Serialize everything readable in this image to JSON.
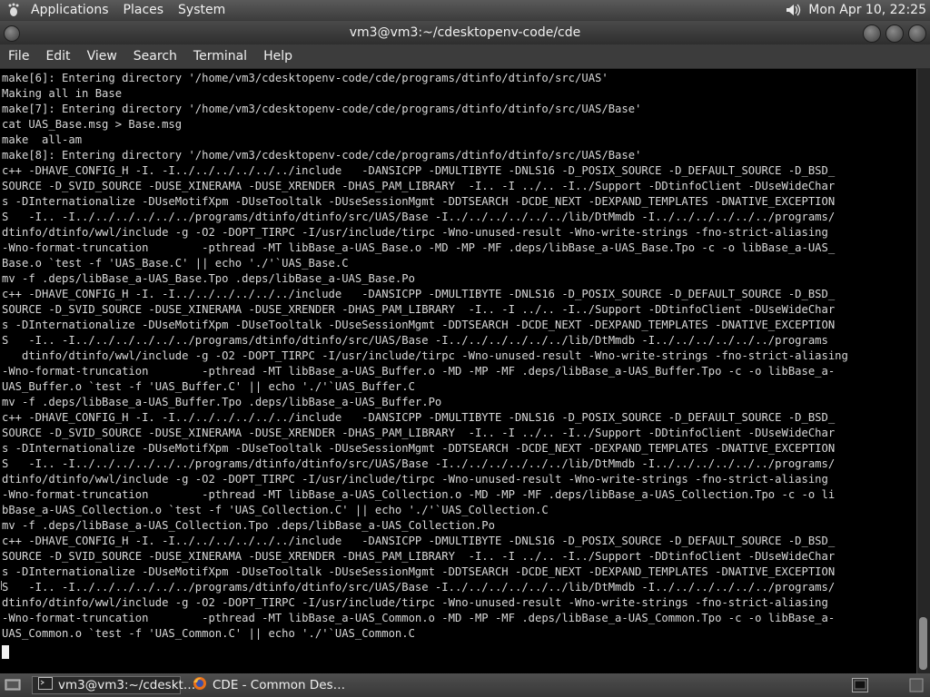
{
  "top_panel": {
    "menus": [
      "Applications",
      "Places",
      "System"
    ],
    "clock": "Mon Apr 10, 22:25"
  },
  "window": {
    "title": "vm3@vm3:~/cdesktopenv-code/cde",
    "menu": [
      "File",
      "Edit",
      "View",
      "Search",
      "Terminal",
      "Help"
    ]
  },
  "terminal": {
    "lines": [
      "make[6]: Entering directory '/home/vm3/cdesktopenv-code/cde/programs/dtinfo/dtinfo/src/UAS'",
      "Making all in Base",
      "make[7]: Entering directory '/home/vm3/cdesktopenv-code/cde/programs/dtinfo/dtinfo/src/UAS/Base'",
      "cat UAS_Base.msg > Base.msg",
      "make  all-am",
      "make[8]: Entering directory '/home/vm3/cdesktopenv-code/cde/programs/dtinfo/dtinfo/src/UAS/Base'",
      "c++ -DHAVE_CONFIG_H -I. -I../../../../../../include   -DANSICPP -DMULTIBYTE -DNLS16 -D_POSIX_SOURCE -D_DEFAULT_SOURCE -D_BSD_",
      "SOURCE -D_SVID_SOURCE -DUSE_XINERAMA -DUSE_XRENDER -DHAS_PAM_LIBRARY  -I.. -I ../.. -I../Support -DDtinfoClient -DUseWideChar",
      "s -DInternationalize -DUseMotifXpm -DUseTooltalk -DUseSessionMgmt -DDTSEARCH -DCDE_NEXT -DEXPAND_TEMPLATES -DNATIVE_EXCEPTION",
      "S   -I.. -I../../../../../../programs/dtinfo/dtinfo/src/UAS/Base -I../../../../../../lib/DtMmdb -I../../../../../../programs/",
      "dtinfo/dtinfo/wwl/include -g -O2 -DOPT_TIRPC -I/usr/include/tirpc -Wno-unused-result -Wno-write-strings -fno-strict-aliasing",
      "-Wno-format-truncation        -pthread -MT libBase_a-UAS_Base.o -MD -MP -MF .deps/libBase_a-UAS_Base.Tpo -c -o libBase_a-UAS_",
      "Base.o `test -f 'UAS_Base.C' || echo './'`UAS_Base.C",
      "mv -f .deps/libBase_a-UAS_Base.Tpo .deps/libBase_a-UAS_Base.Po",
      "c++ -DHAVE_CONFIG_H -I. -I../../../../../../include   -DANSICPP -DMULTIBYTE -DNLS16 -D_POSIX_SOURCE -D_DEFAULT_SOURCE -D_BSD_",
      "SOURCE -D_SVID_SOURCE -DUSE_XINERAMA -DUSE_XRENDER -DHAS_PAM_LIBRARY  -I.. -I ../.. -I../Support -DDtinfoClient -DUseWideChar",
      "s -DInternationalize -DUseMotifXpm -DUseTooltalk -DUseSessionMgmt -DDTSEARCH -DCDE_NEXT -DEXPAND_TEMPLATES -DNATIVE_EXCEPTION",
      "S   -I.. -I../../../../../../programs/dtinfo/dtinfo/src/UAS/Base -I../../../../../../lib/DtMmdb -I../../../../../../programs",
      "   dtinfo/dtinfo/wwl/include -g -O2 -DOPT_TIRPC -I/usr/include/tirpc -Wno-unused-result -Wno-write-strings -fno-strict-aliasing",
      "-Wno-format-truncation        -pthread -MT libBase_a-UAS_Buffer.o -MD -MP -MF .deps/libBase_a-UAS_Buffer.Tpo -c -o libBase_a-",
      "UAS_Buffer.o `test -f 'UAS_Buffer.C' || echo './'`UAS_Buffer.C",
      "mv -f .deps/libBase_a-UAS_Buffer.Tpo .deps/libBase_a-UAS_Buffer.Po",
      "c++ -DHAVE_CONFIG_H -I. -I../../../../../../include   -DANSICPP -DMULTIBYTE -DNLS16 -D_POSIX_SOURCE -D_DEFAULT_SOURCE -D_BSD_",
      "SOURCE -D_SVID_SOURCE -DUSE_XINERAMA -DUSE_XRENDER -DHAS_PAM_LIBRARY  -I.. -I ../.. -I../Support -DDtinfoClient -DUseWideChar",
      "s -DInternationalize -DUseMotifXpm -DUseTooltalk -DUseSessionMgmt -DDTSEARCH -DCDE_NEXT -DEXPAND_TEMPLATES -DNATIVE_EXCEPTION",
      "S   -I.. -I../../../../../../programs/dtinfo/dtinfo/src/UAS/Base -I../../../../../../lib/DtMmdb -I../../../../../../programs/",
      "dtinfo/dtinfo/wwl/include -g -O2 -DOPT_TIRPC -I/usr/include/tirpc -Wno-unused-result -Wno-write-strings -fno-strict-aliasing",
      "-Wno-format-truncation        -pthread -MT libBase_a-UAS_Collection.o -MD -MP -MF .deps/libBase_a-UAS_Collection.Tpo -c -o li",
      "bBase_a-UAS_Collection.o `test -f 'UAS_Collection.C' || echo './'`UAS_Collection.C",
      "mv -f .deps/libBase_a-UAS_Collection.Tpo .deps/libBase_a-UAS_Collection.Po",
      "c++ -DHAVE_CONFIG_H -I. -I../../../../../../include   -DANSICPP -DMULTIBYTE -DNLS16 -D_POSIX_SOURCE -D_DEFAULT_SOURCE -D_BSD_",
      "SOURCE -D_SVID_SOURCE -DUSE_XINERAMA -DUSE_XRENDER -DHAS_PAM_LIBRARY  -I.. -I ../.. -I../Support -DDtinfoClient -DUseWideChar",
      "s -DInternationalize -DUseMotifXpm -DUseTooltalk -DUseSessionMgmt -DDTSEARCH -DCDE_NEXT -DEXPAND_TEMPLATES -DNATIVE_EXCEPTION",
      "S   -I.. -I../../../../../../programs/dtinfo/dtinfo/src/UAS/Base -I../../../../../../lib/DtMmdb -I../../../../../../programs/",
      "dtinfo/dtinfo/wwl/include -g -O2 -DOPT_TIRPC -I/usr/include/tirpc -Wno-unused-result -Wno-write-strings -fno-strict-aliasing",
      "-Wno-format-truncation        -pthread -MT libBase_a-UAS_Common.o -MD -MP -MF .deps/libBase_a-UAS_Common.Tpo -c -o libBase_a-",
      "UAS_Common.o `test -f 'UAS_Common.C' || echo './'`UAS_Common.C"
    ]
  },
  "taskbar": {
    "tasks": [
      "vm3@vm3:~/cdeskt…",
      "CDE - Common Des…"
    ]
  },
  "icons": {
    "foot": "gnome-foot-icon",
    "volume": "speaker-icon",
    "terminal": "terminal-icon",
    "firefox": "firefox-icon"
  }
}
